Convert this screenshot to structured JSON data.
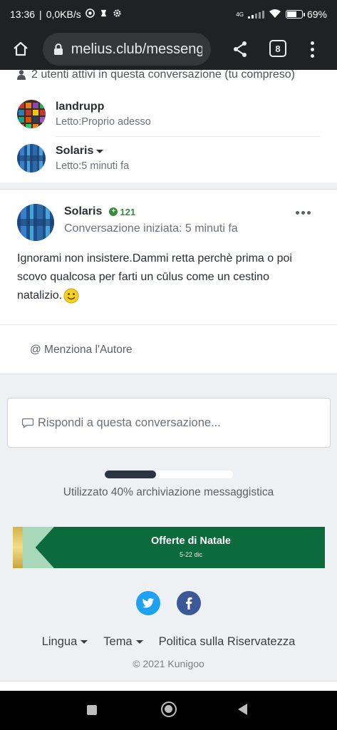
{
  "status_bar": {
    "time": "13:36",
    "speed": "0,0KB/s",
    "network": "4G",
    "battery": "69%",
    "battery_level": 0.69
  },
  "browser": {
    "url": "melius.club/messeng",
    "tab_count": "8"
  },
  "participants": {
    "active_text": "2 utenti attivi in questa conversazione (tu compreso)",
    "items": [
      {
        "name": "landrupp",
        "status": "Letto:Proprio adesso"
      },
      {
        "name": "Solaris",
        "status": "Letto:5 minuti fa"
      }
    ]
  },
  "message": {
    "author": "Solaris",
    "reputation": "121",
    "started": "Conversazione iniziata: 5 minuti fa",
    "body": "Ignorami non insistere.Dammi retta perchè prima o poi scovo qualcosa per farti un cūlus come un cestino natalizio.",
    "mention_label": "@ Menziona l'Autore"
  },
  "reply": {
    "placeholder": "Rispondi a questa conversazione..."
  },
  "storage": {
    "percent": 40,
    "text": "Utilizzato 40% archiviazione messaggistica"
  },
  "ad": {
    "title": "Offerte di Natale",
    "subtitle": "5-22 dic"
  },
  "footer": {
    "language": "Lingua",
    "theme": "Tema",
    "privacy": "Politica sulla Riservatezza",
    "copyright": "© 2021 Kunigoo"
  },
  "colors": {
    "reputation": "#3a8b3f",
    "ad_background": "#0c6b3c",
    "twitter": "#1da1f2",
    "facebook": "#3b5998"
  }
}
